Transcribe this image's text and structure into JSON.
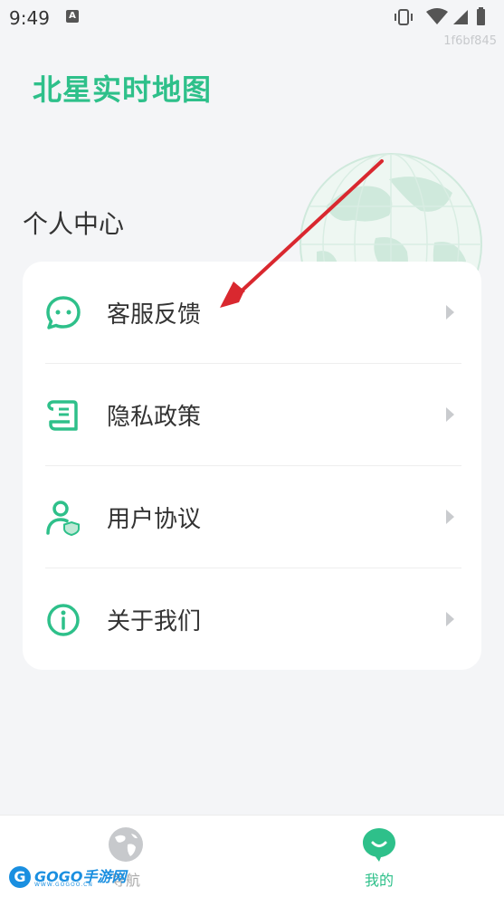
{
  "status_bar": {
    "time": "9:49",
    "notification_icon": "A"
  },
  "device_id": "1f6bf845",
  "app": {
    "title": "北星实时地图",
    "accent_color": "#2ec08a"
  },
  "section": {
    "title": "个人中心"
  },
  "menu": {
    "items": [
      {
        "label": "客服反馈",
        "icon": "chat-bubble-icon"
      },
      {
        "label": "隐私政策",
        "icon": "document-scroll-icon"
      },
      {
        "label": "用户协议",
        "icon": "user-shield-icon"
      },
      {
        "label": "关于我们",
        "icon": "info-circle-icon"
      }
    ]
  },
  "bottom_nav": {
    "tabs": [
      {
        "label": "导航",
        "icon": "globe-icon",
        "active": false
      },
      {
        "label": "我的",
        "icon": "chat-smile-icon",
        "active": true
      }
    ]
  },
  "watermark": {
    "text": "GOGO手游网",
    "sub": "WWW.GOGOO.CN"
  }
}
